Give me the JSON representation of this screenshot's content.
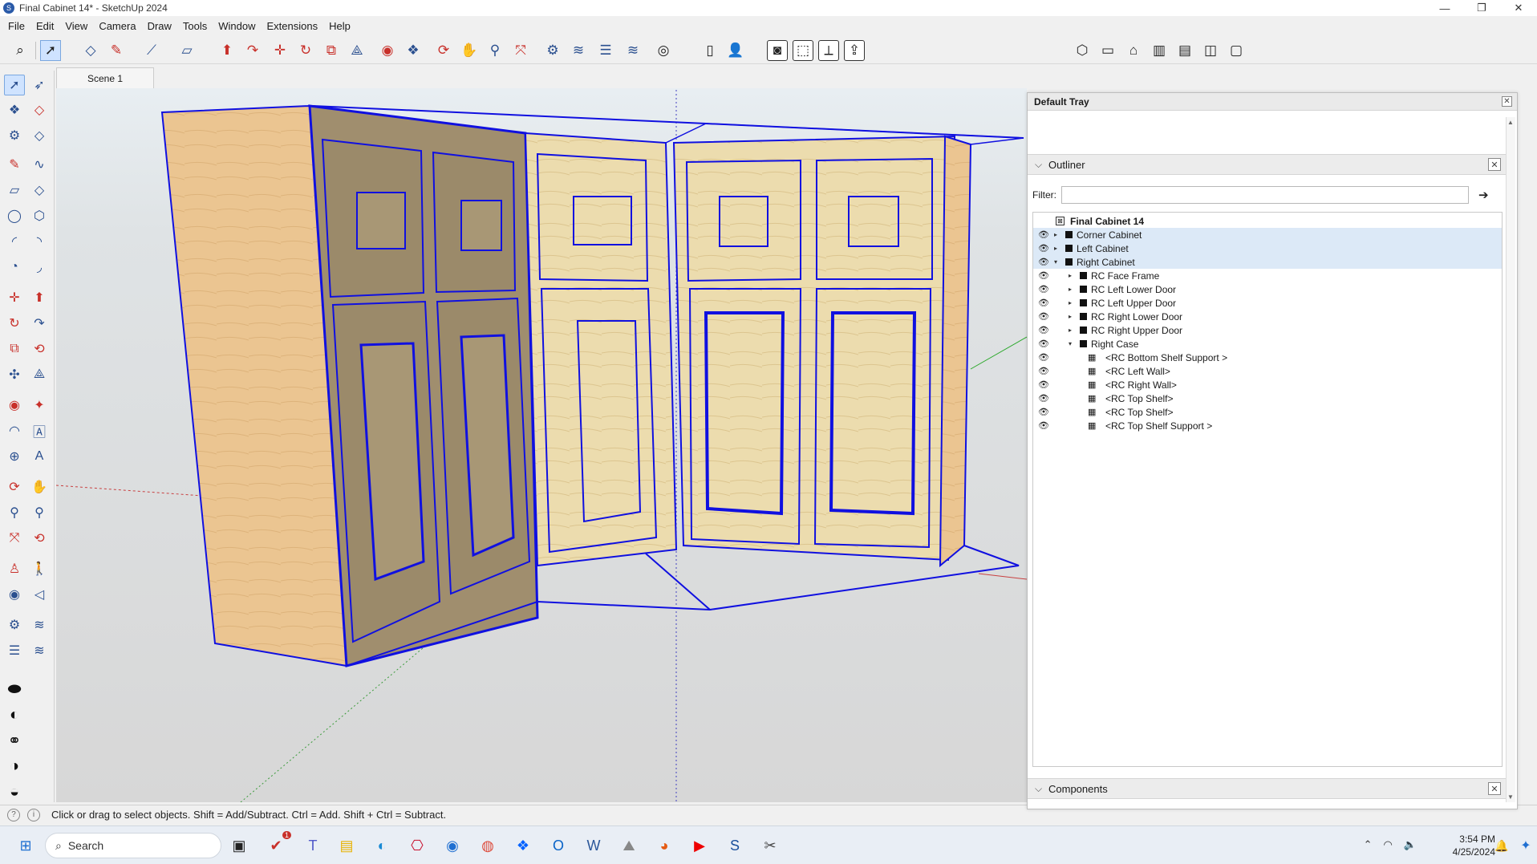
{
  "window": {
    "title": "Final Cabinet 14* - SketchUp 2024",
    "app_icon": "sketchup-icon",
    "minimize": "—",
    "restore": "❐",
    "close": "✕"
  },
  "menu": [
    "File",
    "Edit",
    "View",
    "Camera",
    "Draw",
    "Tools",
    "Window",
    "Extensions",
    "Help"
  ],
  "scene_tab": "Scene 1",
  "status": {
    "help_icon": "?",
    "info_icon": "i",
    "text": "Click or drag to select objects. Shift = Add/Subtract. Ctrl = Add. Shift + Ctrl = Subtract."
  },
  "tray": {
    "title": "Default Tray",
    "outliner": {
      "title": "Outliner",
      "filter_label": "Filter:",
      "filter_value": "",
      "root": "Final Cabinet 14",
      "items": [
        {
          "label": "Corner Cabinet",
          "depth": 1,
          "expand": "▸",
          "type": "component",
          "highlight": true
        },
        {
          "label": "Left Cabinet",
          "depth": 1,
          "expand": "▸",
          "type": "component",
          "highlight": true
        },
        {
          "label": "Right Cabinet",
          "depth": 1,
          "expand": "▾",
          "type": "component",
          "highlight": true
        },
        {
          "label": "RC Face Frame",
          "depth": 2,
          "expand": "▸",
          "type": "component",
          "highlight": false
        },
        {
          "label": "RC Left Lower Door",
          "depth": 2,
          "expand": "▸",
          "type": "component",
          "highlight": false
        },
        {
          "label": "RC Left Upper Door",
          "depth": 2,
          "expand": "▸",
          "type": "component",
          "highlight": false
        },
        {
          "label": "RC Right Lower Door",
          "depth": 2,
          "expand": "▸",
          "type": "component",
          "highlight": false
        },
        {
          "label": "RC Right Upper Door",
          "depth": 2,
          "expand": "▸",
          "type": "component",
          "highlight": false
        },
        {
          "label": "Right Case",
          "depth": 2,
          "expand": "▾",
          "type": "component",
          "highlight": false
        },
        {
          "label": "<RC Bottom Shelf Support >",
          "depth": 3,
          "expand": "",
          "type": "group",
          "highlight": false
        },
        {
          "label": "<RC Left Wall>",
          "depth": 3,
          "expand": "",
          "type": "group",
          "highlight": false
        },
        {
          "label": "<RC Right Wall>",
          "depth": 3,
          "expand": "",
          "type": "group",
          "highlight": false
        },
        {
          "label": "<RC Top Shelf>",
          "depth": 3,
          "expand": "",
          "type": "group",
          "highlight": false
        },
        {
          "label": "<RC Top Shelf>",
          "depth": 3,
          "expand": "",
          "type": "group",
          "highlight": false
        },
        {
          "label": "<RC Top Shelf Support >",
          "depth": 3,
          "expand": "",
          "type": "group",
          "highlight": false
        }
      ]
    },
    "components": {
      "title": "Components"
    }
  },
  "taskbar": {
    "search_placeholder": "Search",
    "time": "3:54 PM",
    "date": "4/25/2024",
    "notification_badge": "1"
  },
  "colors": {
    "selection_blue": "#1010e0",
    "wood_light": "#ecdcae",
    "wood_side": "#e8c48f",
    "highlight_row": "#dce9f7"
  }
}
